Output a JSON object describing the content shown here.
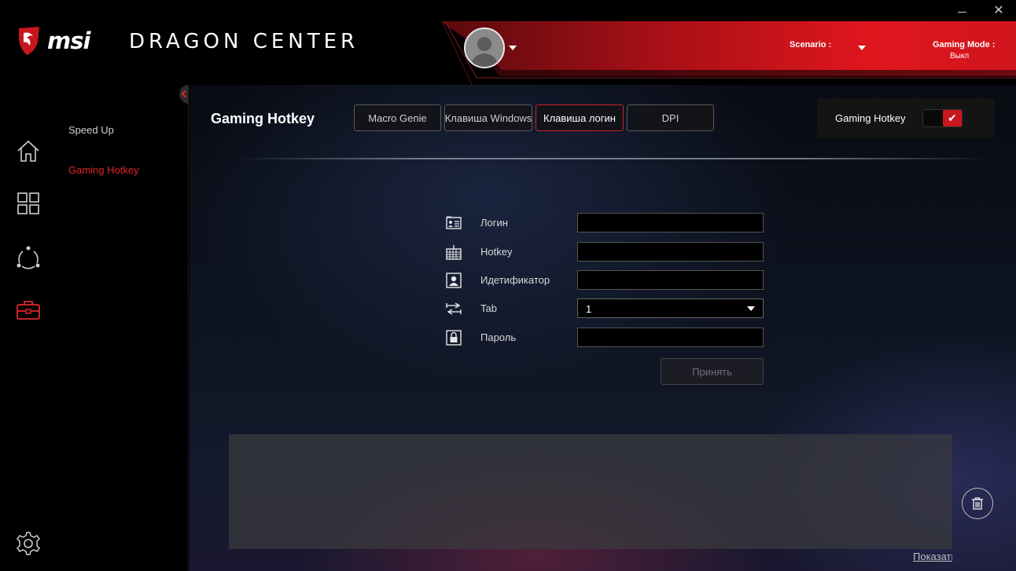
{
  "header": {
    "logo_text": "msi",
    "app_title": "DRAGON CENTER",
    "scenario_label": "Scenario :",
    "gaming_mode_label": "Gaming Mode :",
    "gaming_mode_value": "Выкл",
    "accent_color": "#e0262b"
  },
  "window_controls": {
    "close_glyph": "✕"
  },
  "rail": {
    "items": [
      {
        "icon": "home-icon"
      },
      {
        "icon": "grid-icon"
      },
      {
        "icon": "network-icon"
      },
      {
        "icon": "toolbox-icon",
        "active": true
      }
    ],
    "settings_icon": "gear-icon"
  },
  "submenu": {
    "items": [
      {
        "label": "Speed Up"
      },
      {
        "label": "Gaming Hotkey",
        "active": true
      }
    ]
  },
  "main": {
    "title": "Gaming Hotkey",
    "tabs": [
      {
        "label": "Macro Genie"
      },
      {
        "label": "Клавиша Windows"
      },
      {
        "label": "Клавиша логин",
        "active": true
      },
      {
        "label": "DPI"
      }
    ],
    "hotkey_panel": {
      "label": "Gaming Hotkey",
      "enabled": true,
      "check_glyph": "✔"
    },
    "form": {
      "login_label": "Логин",
      "login_value": "",
      "hotkey_label": "Hotkey",
      "hotkey_value": "",
      "identifier_label": "Идетификатор",
      "identifier_value": "",
      "tab_label": "Tab",
      "tab_value": "1",
      "password_label": "Пароль",
      "password_value": ""
    },
    "apply_label": "Принять",
    "show_link": "Показать"
  }
}
